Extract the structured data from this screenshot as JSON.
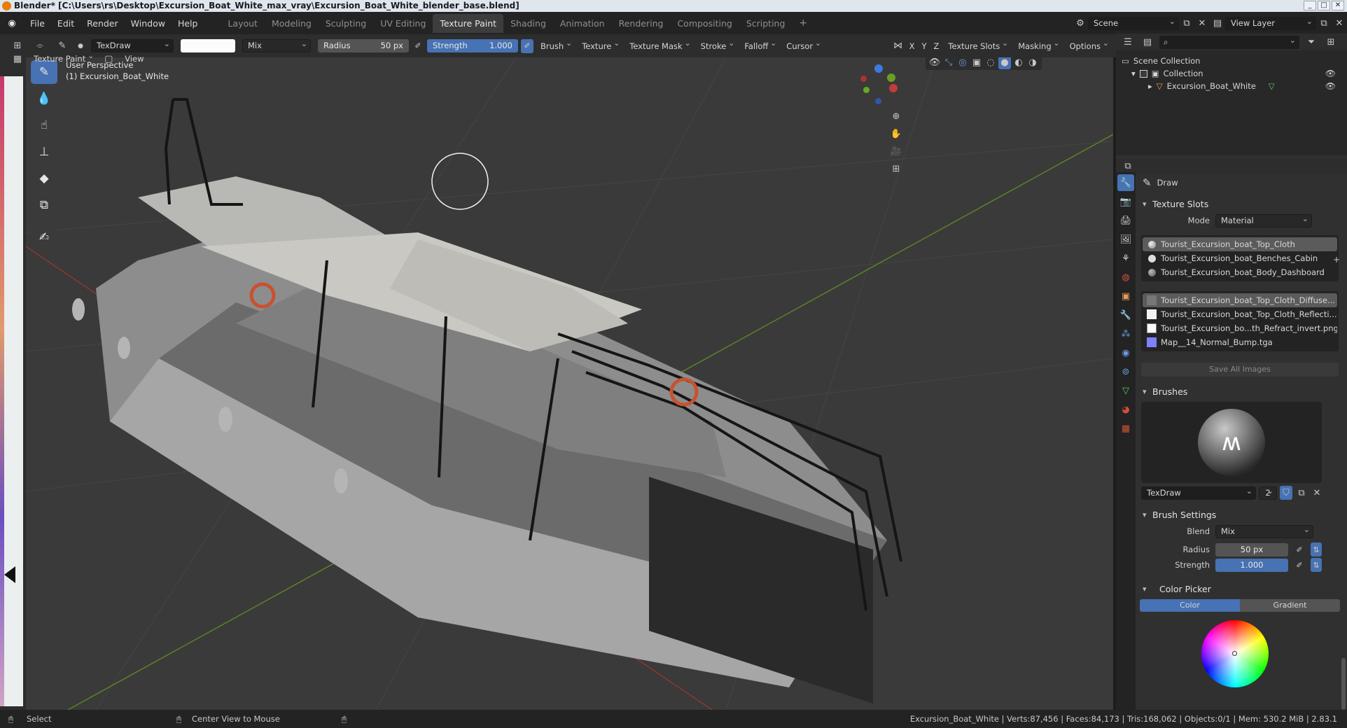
{
  "window": {
    "title": "Blender* [C:\\Users\\rs\\Desktop\\Excursion_Boat_White_max_vray\\Excursion_Boat_White_blender_base.blend]",
    "buttons": [
      "_",
      "□",
      "✕"
    ]
  },
  "menu": {
    "items": [
      "File",
      "Edit",
      "Render",
      "Window",
      "Help"
    ],
    "workspaces": [
      "Layout",
      "Modeling",
      "Sculpting",
      "UV Editing",
      "Texture Paint",
      "Shading",
      "Animation",
      "Rendering",
      "Compositing",
      "Scripting"
    ],
    "active_workspace": "Texture Paint",
    "add_workspace": "+",
    "scene_label": "Scene",
    "view_layer_label": "View Layer"
  },
  "tool_header": {
    "brush_name": "TexDraw",
    "blend_mode": "Mix",
    "radius_label": "Radius",
    "radius_value": "50 px",
    "strength_label": "Strength",
    "strength_value": "1.000",
    "menus": [
      "Brush",
      "Texture",
      "Texture Mask",
      "Stroke",
      "Falloff",
      "Cursor"
    ],
    "axes": [
      "X",
      "Y",
      "Z"
    ],
    "right_menus": [
      "Texture Slots",
      "Masking",
      "Options"
    ]
  },
  "mode_header": {
    "mode": "Texture Paint",
    "view_label": "View"
  },
  "viewport": {
    "perspective_label": "User Perspective",
    "object_label": "(1) Excursion_Boat_White",
    "brush_cursor_radius": 50
  },
  "outliner": {
    "scene_collection": "Scene Collection",
    "collection": "Collection",
    "object": "Excursion_Boat_White"
  },
  "properties": {
    "tool_name": "Draw",
    "texture_slots": {
      "title": "Texture Slots",
      "mode_label": "Mode",
      "mode_value": "Material",
      "materials": [
        "Tourist_Excursion_boat_Top_Cloth",
        "Tourist_Excursion_boat_Benches_Cabin",
        "Tourist_Excursion_boat_Body_Dashboard"
      ],
      "images": [
        "Tourist_Excursion_boat_Top_Cloth_Diffuse...",
        "Tourist_Excursion_boat_Top_Cloth_Reflecti...",
        "Tourist_Excursion_bo...th_Refract_invert.png",
        "Map__14_Normal_Bump.tga"
      ],
      "save_all": "Save All Images"
    },
    "brushes": {
      "title": "Brushes",
      "brush_name": "TexDraw",
      "users": "2"
    },
    "brush_settings": {
      "title": "Brush Settings",
      "blend_label": "Blend",
      "blend_value": "Mix",
      "radius_label": "Radius",
      "radius_value": "50 px",
      "strength_label": "Strength",
      "strength_value": "1.000"
    },
    "color_picker": {
      "title": "Color Picker",
      "tab_color": "Color",
      "tab_gradient": "Gradient"
    }
  },
  "status": {
    "select": "Select",
    "center_view": "Center View to Mouse",
    "stats": "Excursion_Boat_White | Verts:87,456 | Faces:84,173 | Tris:168,062 | Objects:0/1 | Mem: 530.2 MiB | 2.83.1"
  },
  "colors": {
    "accent_blue": "#4772b3",
    "viewport_bg": "#3a3a3a",
    "x_axis": "#c43b3b",
    "y_axis": "#6d9c25",
    "z_axis": "#3b7be0"
  }
}
